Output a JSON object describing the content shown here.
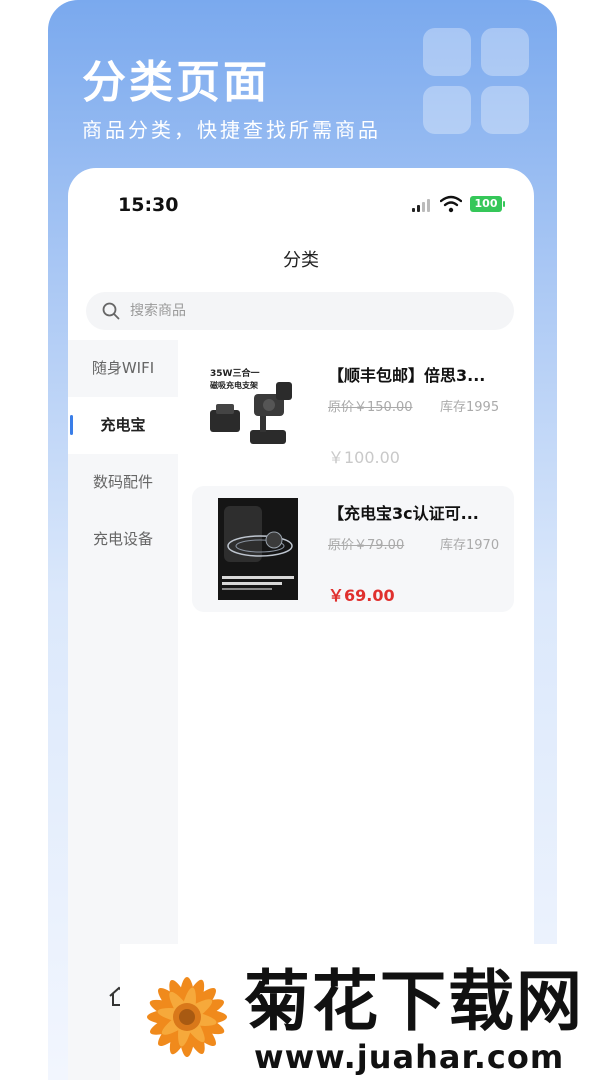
{
  "promo": {
    "title": "分类页面",
    "subtitle": "商品分类，快捷查找所需商品"
  },
  "status_bar": {
    "time": "15:30",
    "battery": "100",
    "icons": [
      "signal-icon",
      "wifi-icon",
      "battery-icon"
    ]
  },
  "nav": {
    "title": "分类"
  },
  "search": {
    "placeholder": "搜索商品",
    "value": ""
  },
  "sidebar": {
    "items": [
      {
        "label": "随身WIFI",
        "active": false
      },
      {
        "label": "充电宝",
        "active": true
      },
      {
        "label": "数码配件",
        "active": false
      },
      {
        "label": "充电设备",
        "active": false
      }
    ]
  },
  "products": [
    {
      "name": "【顺丰包邮】倍思3...",
      "original_price": "原价￥150.00",
      "stock": "库存1995",
      "price": "￥100.00",
      "image_text": [
        "35W三合一",
        "磁吸充电支架"
      ]
    },
    {
      "name": "【充电宝3c认证可...",
      "original_price": "原价￥79.00",
      "stock": "库存1970",
      "price": "￥69.00",
      "image_text": []
    }
  ],
  "watermark": {
    "title": "菊花下载网",
    "url": "www.juahar.com"
  },
  "colors": {
    "accent": "#3a7ee8",
    "price_red": "#e0302e",
    "battery_green": "#35c759",
    "promo_blue": "#7aa9ee"
  }
}
